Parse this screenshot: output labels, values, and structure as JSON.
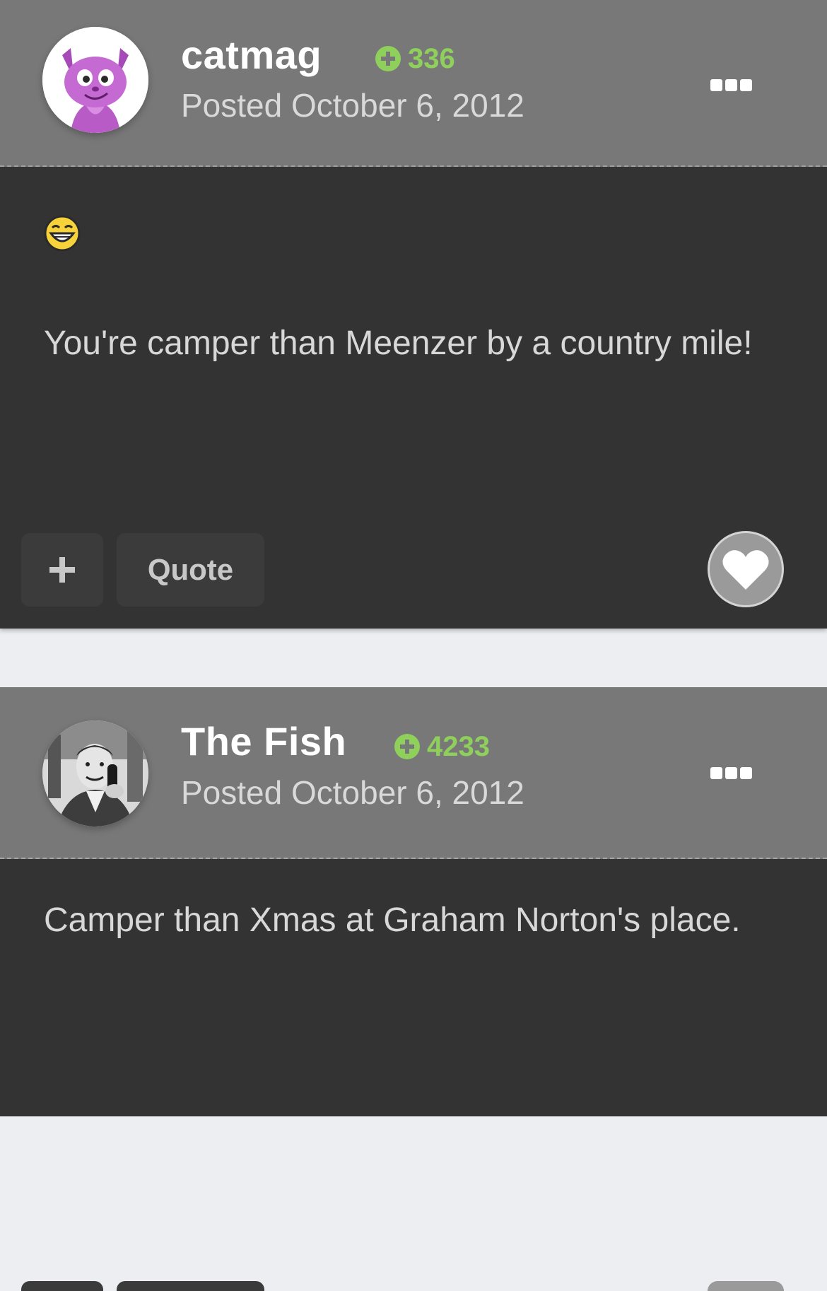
{
  "posts": [
    {
      "author": "catmag",
      "reputation": "336",
      "posted": "Posted October 6, 2012",
      "message": "You're camper than Meenzer by a country mile!",
      "icons": {
        "avatar": "pink-cat-avatar",
        "emoji": "laughing-smiley-icon",
        "menu": "more-options-icon"
      },
      "actions": {
        "quote_label": "Quote"
      }
    },
    {
      "author": "The Fish",
      "reputation": "4233",
      "posted": "Posted October 6, 2012",
      "message": "Camper than Xmas at Graham Norton's place.",
      "icons": {
        "avatar": "man-on-telephone-avatar",
        "menu": "more-options-icon"
      }
    }
  ],
  "colors": {
    "header_bg": "#787878",
    "body_bg": "#333333",
    "reputation": "#8fcf5c",
    "page_bg": "#eceef1"
  }
}
